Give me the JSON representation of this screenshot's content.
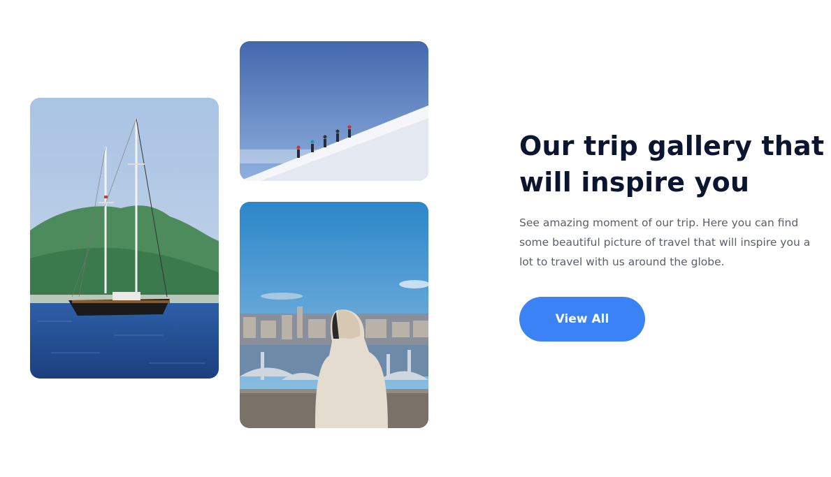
{
  "gallery": {
    "heading": "Our trip gallery that will inspire you",
    "description": "See amazing moment of our trip. Here you can find some beautiful picture of travel that will inspire you a lot to travel with us around the globe.",
    "button_label": "View All",
    "photos": [
      {
        "subject": "sailboat-on-sea"
      },
      {
        "subject": "climbers-on-snowy-slope"
      },
      {
        "subject": "person-overlooking-city"
      }
    ]
  },
  "colors": {
    "heading": "#0b1530",
    "body_text": "#5a5f6b",
    "button": "#3b82f6",
    "button_text": "#ffffff",
    "background": "#ffffff"
  }
}
